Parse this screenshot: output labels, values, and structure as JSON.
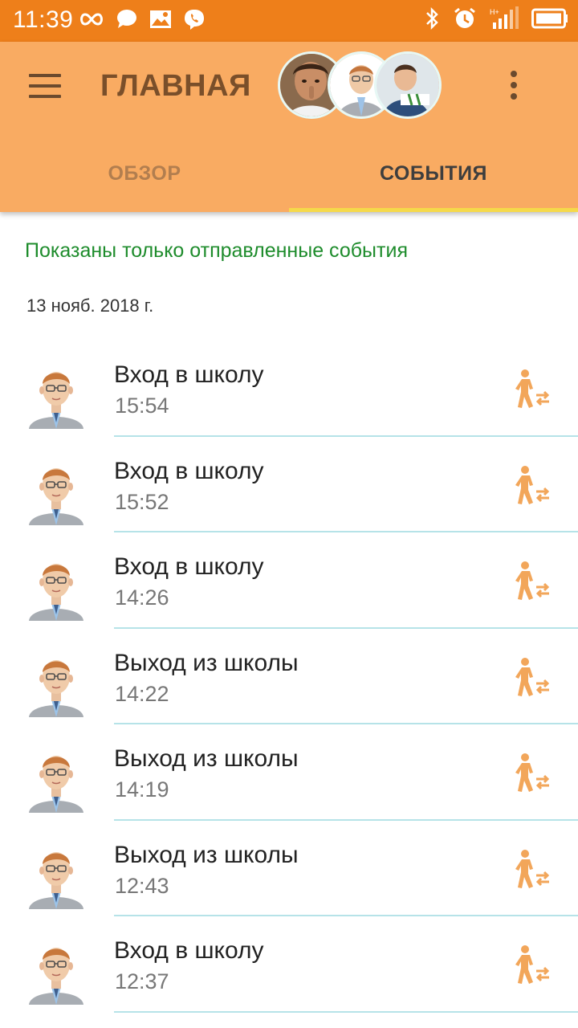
{
  "status_bar": {
    "time": "11:39",
    "left_icons": [
      "infinity-icon",
      "chat-bubble-icon",
      "image-icon",
      "viber-icon"
    ],
    "right_icons": [
      "bluetooth-icon",
      "alarm-icon",
      "signal-icon",
      "battery-icon"
    ]
  },
  "app_bar": {
    "title": "ГЛАВНАЯ",
    "accent_color": "#f9ab62",
    "status_color": "#ee7f1a"
  },
  "tabs": [
    {
      "label": "ОБЗОР",
      "active": false
    },
    {
      "label": "СОБЫТИЯ",
      "active": true
    }
  ],
  "notice": "Показаны только отправленные события",
  "date": "13 нояб. 2018 г.",
  "events": [
    {
      "title": "Вход в школу",
      "time": "15:54"
    },
    {
      "title": "Вход в школу",
      "time": "15:52"
    },
    {
      "title": "Вход в школу",
      "time": "14:26"
    },
    {
      "title": "Выход из школы",
      "time": "14:22"
    },
    {
      "title": "Выход из школы",
      "time": "14:19"
    },
    {
      "title": "Выход из школы",
      "time": "12:43"
    },
    {
      "title": "Вход в школу",
      "time": "12:37"
    }
  ]
}
